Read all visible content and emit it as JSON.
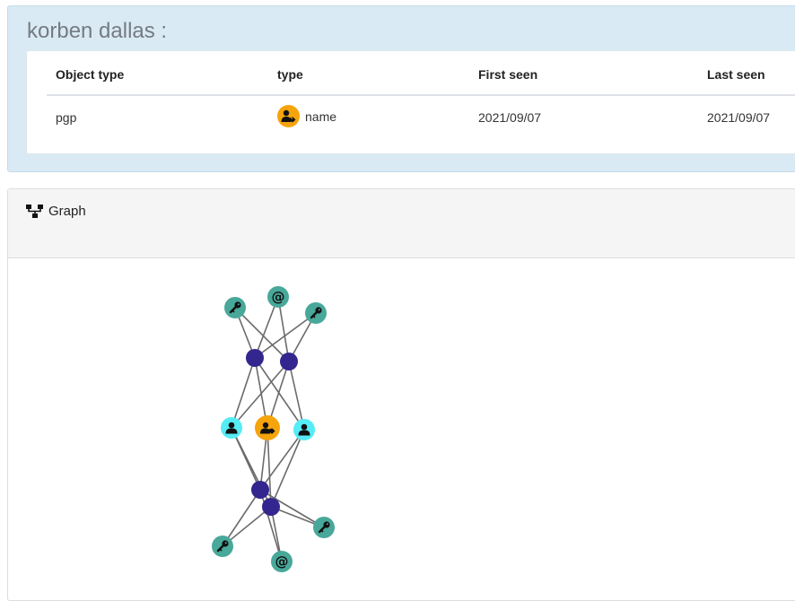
{
  "title": "korben dallas :",
  "table": {
    "headers": [
      "Object type",
      "type",
      "First seen",
      "Last seen"
    ],
    "row": {
      "object_type": "pgp",
      "type_icon": "user-tag-icon",
      "type_label": "name",
      "first_seen": "2021/09/07",
      "last_seen": "2021/09/07"
    }
  },
  "graph": {
    "heading": "Graph",
    "heading_icon": "sitemap-icon",
    "colors": {
      "edge": "#6b6b6b",
      "teal": "#48a89a",
      "indigo": "#33268f",
      "cyan": "#55ecf5",
      "orange": "#f5a40c"
    },
    "nodes": [
      {
        "id": "k1",
        "kind": "key",
        "color": "teal",
        "icon": "key-icon"
      },
      {
        "id": "e1",
        "kind": "email",
        "color": "teal",
        "icon": "at-icon"
      },
      {
        "id": "k2",
        "kind": "key",
        "color": "teal",
        "icon": "key-icon"
      },
      {
        "id": "p1",
        "kind": "hub",
        "color": "indigo",
        "icon": ""
      },
      {
        "id": "p2",
        "kind": "hub",
        "color": "indigo",
        "icon": ""
      },
      {
        "id": "u1",
        "kind": "user",
        "color": "cyan",
        "icon": "user-icon"
      },
      {
        "id": "n1",
        "kind": "name",
        "color": "orange",
        "icon": "user-tag-icon"
      },
      {
        "id": "u2",
        "kind": "user",
        "color": "cyan",
        "icon": "user-icon"
      },
      {
        "id": "p3",
        "kind": "hub",
        "color": "indigo",
        "icon": ""
      },
      {
        "id": "p4",
        "kind": "hub",
        "color": "indigo",
        "icon": ""
      },
      {
        "id": "k3",
        "kind": "key",
        "color": "teal",
        "icon": "key-icon"
      },
      {
        "id": "k4",
        "kind": "key",
        "color": "teal",
        "icon": "key-icon"
      },
      {
        "id": "e2",
        "kind": "email",
        "color": "teal",
        "icon": "at-icon"
      }
    ],
    "edges": [
      [
        "k1",
        "p1"
      ],
      [
        "k1",
        "p2"
      ],
      [
        "e1",
        "p1"
      ],
      [
        "e1",
        "p2"
      ],
      [
        "k2",
        "p1"
      ],
      [
        "k2",
        "p2"
      ],
      [
        "p1",
        "u1"
      ],
      [
        "p1",
        "n1"
      ],
      [
        "p1",
        "u2"
      ],
      [
        "p2",
        "u1"
      ],
      [
        "p2",
        "n1"
      ],
      [
        "p2",
        "u2"
      ],
      [
        "u1",
        "p3"
      ],
      [
        "u1",
        "p4"
      ],
      [
        "n1",
        "p3"
      ],
      [
        "n1",
        "p4"
      ],
      [
        "u2",
        "p3"
      ],
      [
        "u2",
        "p4"
      ],
      [
        "p3",
        "k3"
      ],
      [
        "p3",
        "k4"
      ],
      [
        "p3",
        "e2"
      ],
      [
        "p4",
        "k3"
      ],
      [
        "p4",
        "k4"
      ],
      [
        "p4",
        "e2"
      ]
    ]
  }
}
